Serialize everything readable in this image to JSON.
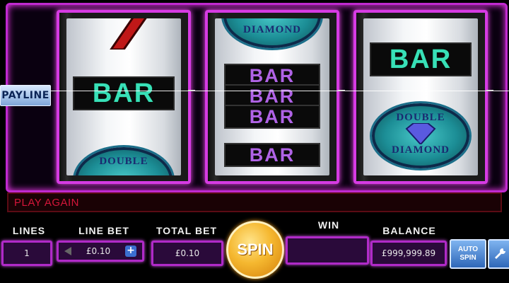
{
  "game": {
    "payline_label": "PAYLINE",
    "message": "PLAY AGAIN",
    "reels": {
      "reel1": {
        "symbol_top": "SEVEN",
        "symbol_mid": "BAR",
        "symbol_bottom": "DOUBLE DIAMOND"
      },
      "reel2": {
        "symbol_top": "DOUBLE DIAMOND",
        "triple_bar": [
          "BAR",
          "BAR",
          "BAR"
        ],
        "symbol_bottom": "BAR"
      },
      "reel3": {
        "symbol_top": "BAR",
        "symbol_mid": "DOUBLE DIAMOND"
      }
    },
    "diamond_word_top": "DOUBLE",
    "diamond_word_bottom": "DIAMOND"
  },
  "controls": {
    "lines_label": "LINES",
    "lines_value": "1",
    "line_bet_label": "LINE BET",
    "line_bet_value": "£0.10",
    "total_bet_label": "TOTAL BET",
    "total_bet_value": "£0.10",
    "spin_label": "SPIN",
    "win_label": "WIN",
    "win_value": "",
    "balance_label": "BALANCE",
    "balance_value": "£999,999.89",
    "autospin_line1": "AUTO",
    "autospin_line2": "SPIN",
    "increase_icon": "plus-icon",
    "decrease_icon": "arrow-left-icon",
    "settings_icon": "wrench-icon"
  },
  "colors": {
    "frame_neon": "#d63be3",
    "bar_teal": "#38e0b8",
    "bar_purple": "#b063e6",
    "message_red": "#d5163a",
    "spin_gold": "#f5b830"
  }
}
